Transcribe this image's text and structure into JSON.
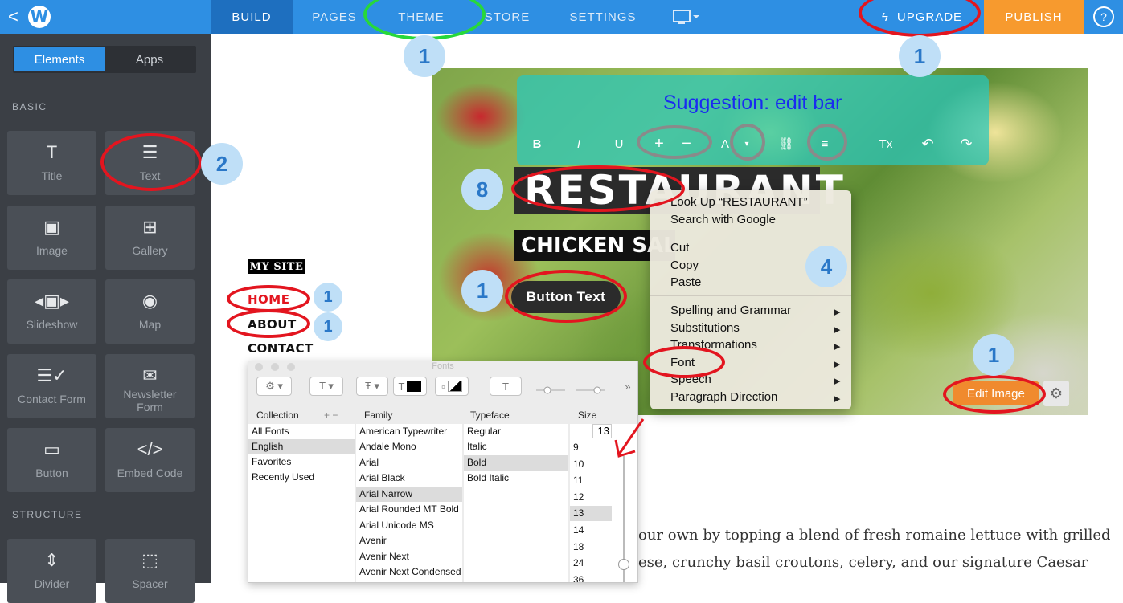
{
  "topbar": {
    "back_icon": "<",
    "logo": "W",
    "nav": [
      "BUILD",
      "PAGES",
      "THEME",
      "STORE",
      "SETTINGS"
    ],
    "upgrade": "UPGRADE",
    "publish": "PUBLISH",
    "help": "?"
  },
  "sidebar": {
    "tabs": [
      "Elements",
      "Apps"
    ],
    "sections": [
      "BASIC",
      "STRUCTURE"
    ],
    "tiles": [
      {
        "label": "Title",
        "icon": "T"
      },
      {
        "label": "Text",
        "icon": "☰"
      },
      {
        "label": "Image",
        "icon": "▣"
      },
      {
        "label": "Gallery",
        "icon": "⊞"
      },
      {
        "label": "Slideshow",
        "icon": "◂▣▸"
      },
      {
        "label": "Map",
        "icon": "◉"
      },
      {
        "label": "Contact Form",
        "icon": "☰✓"
      },
      {
        "label": "Newsletter Form",
        "icon": "✉"
      },
      {
        "label": "Button",
        "icon": "▭"
      },
      {
        "label": "Embed Code",
        "icon": "</>"
      },
      {
        "label": "Divider",
        "icon": "⇕"
      },
      {
        "label": "Spacer",
        "icon": "⬚"
      }
    ]
  },
  "editor": {
    "suggestion": "Suggestion: edit bar",
    "toolbar": [
      "B",
      "I",
      "U",
      "+",
      "−",
      "A",
      "▾",
      "⛓",
      "≡",
      "Tx",
      "↶",
      "↷"
    ],
    "restaurant": "RESTAURANT",
    "chicken": "CHICKEN SALAD",
    "button_text": "Button Text",
    "edit_image": "Edit Image"
  },
  "context_menu": {
    "items": [
      "Look Up “RESTAURANT”",
      "Search with Google",
      "Cut",
      "Copy",
      "Paste",
      "Spelling and Grammar",
      "Substitutions",
      "Transformations",
      "Font",
      "Speech",
      "Paragraph Direction"
    ]
  },
  "site": {
    "name": "MY SITE",
    "nav": [
      "HOME",
      "ABOUT",
      "CONTACT"
    ]
  },
  "fonts_panel": {
    "title": "Fonts",
    "headers": [
      "Collection",
      "Family",
      "Typeface",
      "Size"
    ],
    "collections": [
      "All Fonts",
      "English",
      "Favorites",
      "Recently Used"
    ],
    "families": [
      "American Typewriter",
      "Andale Mono",
      "Arial",
      "Arial Black",
      "Arial Narrow",
      "Arial Rounded MT Bold",
      "Arial Unicode MS",
      "Avenir",
      "Avenir Next",
      "Avenir Next Condensed"
    ],
    "typefaces": [
      "Regular",
      "Italic",
      "Bold",
      "Bold Italic"
    ],
    "size_value": "13",
    "sizes": [
      "9",
      "10",
      "11",
      "12",
      "13",
      "14",
      "18",
      "24",
      "36"
    ]
  },
  "body_text": {
    "line1": "our own by topping a blend of fresh romaine lettuce with grilled",
    "line2": "ese, crunchy basil croutons, celery, and our signature Caesar"
  },
  "annotations": {
    "numbers": [
      "1",
      "1",
      "2",
      "8",
      "1",
      "4",
      "1",
      "1",
      "1"
    ]
  }
}
